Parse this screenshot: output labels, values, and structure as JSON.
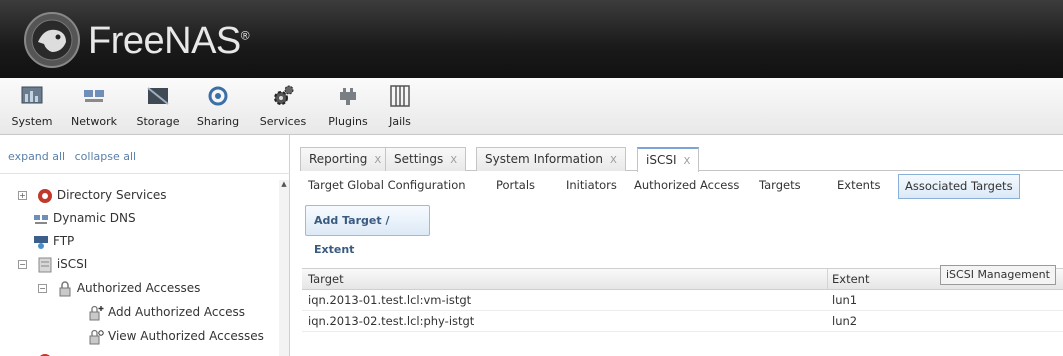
{
  "brand": {
    "name": "FreeNAS",
    "mark": "®"
  },
  "toolbar": [
    {
      "label": "System",
      "icon": "system-icon"
    },
    {
      "label": "Network",
      "icon": "network-icon"
    },
    {
      "label": "Storage",
      "icon": "storage-icon"
    },
    {
      "label": "Sharing",
      "icon": "sharing-icon"
    },
    {
      "label": "Services",
      "icon": "services-icon"
    },
    {
      "label": "Plugins",
      "icon": "plugins-icon"
    },
    {
      "label": "Jails",
      "icon": "jails-icon"
    }
  ],
  "sidebar": {
    "expand_all": "expand all",
    "collapse_all": "collapse all",
    "tree": [
      {
        "label": "Directory Services",
        "icon": "directory-services-icon"
      },
      {
        "label": "Dynamic DNS",
        "icon": "dynamic-dns-icon"
      },
      {
        "label": "FTP",
        "icon": "ftp-icon"
      },
      {
        "label": "iSCSI",
        "icon": "iscsi-icon"
      },
      {
        "label": "Authorized Accesses",
        "icon": "lock-icon"
      },
      {
        "label": "Add Authorized Access",
        "icon": "add-lock-icon"
      },
      {
        "label": "View Authorized Accesses",
        "icon": "view-lock-icon"
      }
    ]
  },
  "tabs": [
    {
      "label": "Reporting"
    },
    {
      "label": "Settings"
    },
    {
      "label": "System Information"
    },
    {
      "label": "iSCSI"
    }
  ],
  "tab_close": "X",
  "submenu": [
    "Target Global Configuration",
    "Portals",
    "Initiators",
    "Authorized Access",
    "Targets",
    "Extents",
    "Associated Targets"
  ],
  "add_button": "Add Target / Extent",
  "grid": {
    "headers": [
      "Target",
      "Extent"
    ],
    "rows": [
      {
        "target": "iqn.2013-01.test.lcl:vm-istgt",
        "extent": "lun1"
      },
      {
        "target": "iqn.2013-02.test.lcl:phy-istgt",
        "extent": "lun2"
      }
    ]
  },
  "tooltip": "iSCSI Management",
  "colors": {
    "header_bg": "#1a1a1a",
    "accent": "#7aa5d6",
    "link": "#5a7fa8"
  }
}
